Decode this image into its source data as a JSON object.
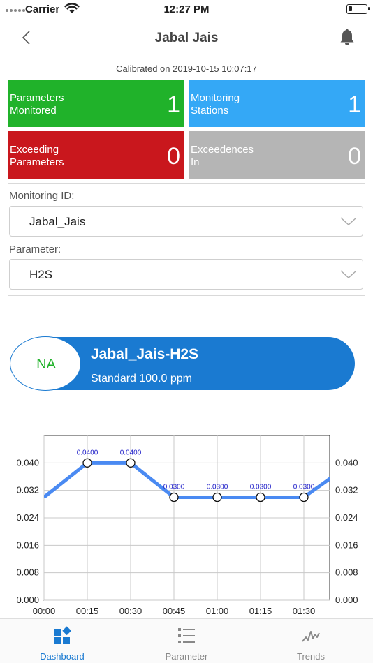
{
  "status_bar": {
    "carrier": "Carrier",
    "time": "12:27 PM"
  },
  "header": {
    "title": "Jabal Jais"
  },
  "calibrated": "Calibrated on 2019-10-15 10:07:17",
  "tiles": {
    "parameters_monitored": {
      "label": "Parameters\nMonitored",
      "value": "1",
      "color": "#20b22a"
    },
    "monitoring_stations": {
      "label": "Monitoring\nStations",
      "value": "1",
      "color": "#34a8f6"
    },
    "exceeding_parameters": {
      "label": "Exceeding\nParameters",
      "value": "0",
      "color": "#c9171d"
    },
    "exceedences_in": {
      "label": "Exceedences\nIn",
      "value": "0",
      "color": "#b5b5b5"
    }
  },
  "monitoring_id": {
    "label": "Monitoring ID:",
    "value": "Jabal_Jais"
  },
  "parameter": {
    "label": "Parameter:",
    "value": "H2S"
  },
  "station": {
    "status": "NA",
    "name": "Jabal_Jais-H2S",
    "standard": "Standard 100.0 ppm"
  },
  "chart_data": {
    "type": "line",
    "x": [
      "00:00",
      "00:15",
      "00:30",
      "00:45",
      "01:00",
      "01:15",
      "01:30",
      "01:40"
    ],
    "x_ticks": [
      "00:00",
      "00:15",
      "00:30",
      "00:45",
      "01:00",
      "01:15",
      "01:30"
    ],
    "values": [
      0.03,
      0.04,
      0.04,
      0.03,
      0.03,
      0.03,
      0.03,
      0.036
    ],
    "markers": [
      {
        "x": "00:15",
        "y": 0.04,
        "label": "0.0400"
      },
      {
        "x": "00:30",
        "y": 0.04,
        "label": "0.0400"
      },
      {
        "x": "00:45",
        "y": 0.03,
        "label": "0.0300"
      },
      {
        "x": "01:00",
        "y": 0.03,
        "label": "0.0300"
      },
      {
        "x": "01:15",
        "y": 0.03,
        "label": "0.0300"
      },
      {
        "x": "01:30",
        "y": 0.03,
        "label": "0.0300"
      }
    ],
    "y_ticks": [
      "0.000",
      "0.008",
      "0.016",
      "0.024",
      "0.032",
      "0.040"
    ],
    "ylim": [
      0,
      0.048
    ],
    "grid": true,
    "line_color": "#4a8af2",
    "label_color": "#1c1cc8"
  },
  "tabs": [
    {
      "label": "Dashboard",
      "icon": "dashboard-icon",
      "active": true
    },
    {
      "label": "Parameter",
      "icon": "list-icon",
      "active": false
    },
    {
      "label": "Trends",
      "icon": "trends-icon",
      "active": false
    }
  ],
  "colors": {
    "accent": "#1a7ad1",
    "good": "#20b22a"
  }
}
